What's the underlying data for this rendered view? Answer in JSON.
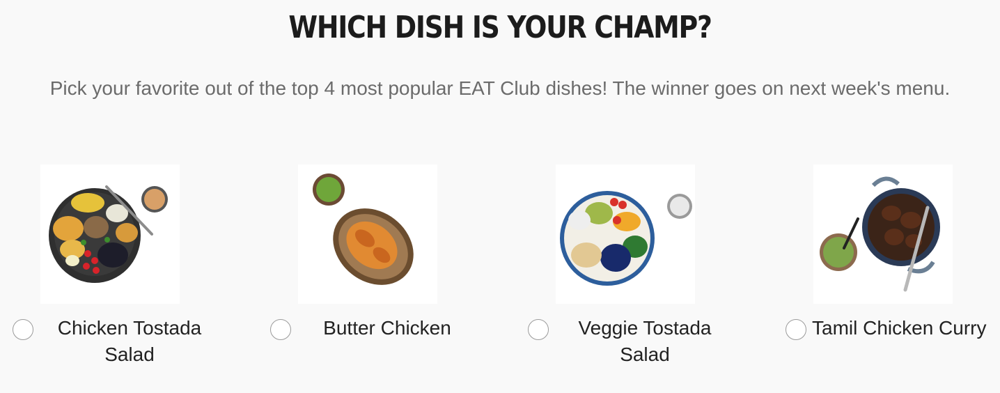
{
  "poll": {
    "title": "WHICH DISH IS YOUR CHAMP?",
    "subtitle": "Pick your favorite out of the top 4 most popular EAT Club dishes! The winner goes on next week's menu.",
    "options": [
      {
        "label": "Chicken Tostada Salad",
        "selected": false
      },
      {
        "label": "Butter Chicken",
        "selected": false
      },
      {
        "label": "Veggie Tostada Salad",
        "selected": false
      },
      {
        "label": "Tamil Chicken Curry",
        "selected": false
      }
    ]
  }
}
